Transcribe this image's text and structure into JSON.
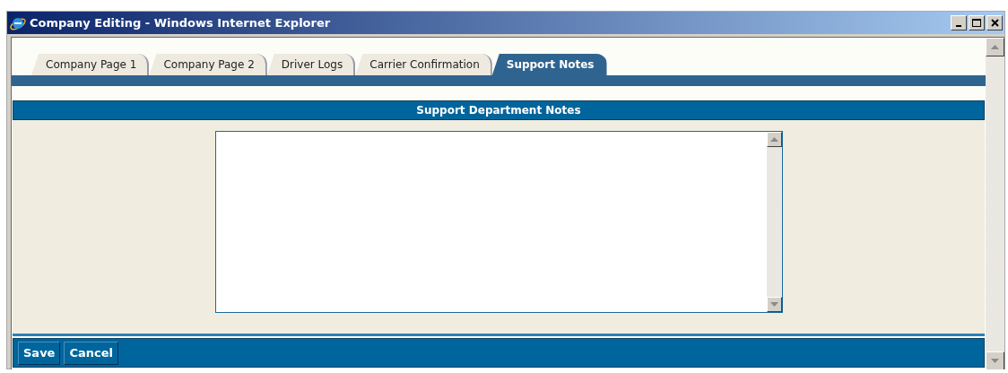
{
  "window": {
    "title": "Company Editing - Windows Internet Explorer"
  },
  "tabs": [
    {
      "label": "Company Page 1",
      "selected": false
    },
    {
      "label": "Company Page 2",
      "selected": false
    },
    {
      "label": "Driver Logs",
      "selected": false
    },
    {
      "label": "Carrier Confirmation",
      "selected": false
    },
    {
      "label": "Support Notes",
      "selected": true
    }
  ],
  "panel": {
    "title": "Support Department Notes"
  },
  "buttons": [
    "Save",
    "Cancel"
  ]
}
